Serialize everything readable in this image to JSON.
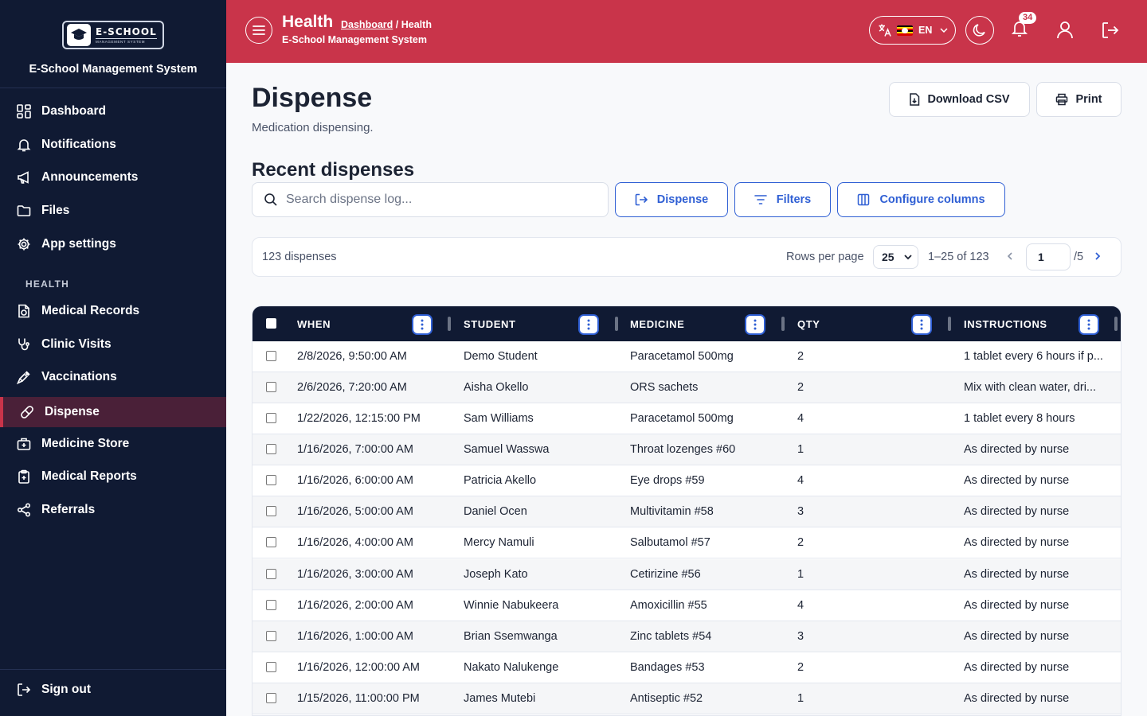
{
  "app": {
    "brand_logo_main": "E-SCHOOL",
    "brand_logo_sub": "MANAGEMENT SYSTEM",
    "brand_name": "E-School Management System"
  },
  "sidebar": {
    "items": [
      {
        "label": "Dashboard",
        "icon": "dashboard-icon"
      },
      {
        "label": "Notifications",
        "icon": "bell-icon"
      },
      {
        "label": "Announcements",
        "icon": "megaphone-icon"
      },
      {
        "label": "Files",
        "icon": "folder-icon"
      },
      {
        "label": "App settings",
        "icon": "gear-icon"
      }
    ],
    "section_label": "HEALTH",
    "health_items": [
      {
        "label": "Medical Records",
        "icon": "medical-file-icon"
      },
      {
        "label": "Clinic Visits",
        "icon": "stethoscope-icon"
      },
      {
        "label": "Vaccinations",
        "icon": "syringe-icon"
      },
      {
        "label": "Dispense",
        "icon": "pill-icon",
        "active": true
      },
      {
        "label": "Medicine Store",
        "icon": "medkit-icon"
      },
      {
        "label": "Medical Reports",
        "icon": "clipboard-plus-icon"
      },
      {
        "label": "Referrals",
        "icon": "share-icon"
      }
    ],
    "signout_label": "Sign out"
  },
  "header": {
    "title": "Health",
    "breadcrumb_link": "Dashboard",
    "breadcrumb_sep": "/",
    "breadcrumb_current": "Health",
    "subtitle": "E-School Management System",
    "language_code": "EN",
    "notification_count": "34",
    "accent_color": "#c9344a"
  },
  "page": {
    "title": "Dispense",
    "subtitle": "Medication dispensing.",
    "download_csv_label": "Download CSV",
    "print_label": "Print",
    "section_title": "Recent dispenses",
    "search_placeholder": "Search dispense log...",
    "dispense_button_label": "Dispense",
    "filters_button_label": "Filters",
    "configure_columns_label": "Configure columns"
  },
  "pager": {
    "count_text": "123 dispenses",
    "rows_per_page_label": "Rows per page",
    "rows_per_page_value": "25",
    "range_text": "1–25 of 123",
    "current_page": "1",
    "total_pages_text": "/5"
  },
  "table": {
    "columns": [
      "WHEN",
      "STUDENT",
      "MEDICINE",
      "QTY",
      "INSTRUCTIONS"
    ],
    "rows": [
      [
        "2/8/2026, 9:50:00 AM",
        "Demo Student",
        "Paracetamol 500mg",
        "2",
        "1 tablet every 6 hours if p..."
      ],
      [
        "2/6/2026, 7:20:00 AM",
        "Aisha Okello",
        "ORS sachets",
        "2",
        "Mix with clean water, dri..."
      ],
      [
        "1/22/2026, 12:15:00 PM",
        "Sam Williams",
        "Paracetamol 500mg",
        "4",
        "1 tablet every 8 hours"
      ],
      [
        "1/16/2026, 7:00:00 AM",
        "Samuel Wasswa",
        "Throat lozenges #60",
        "1",
        "As directed by nurse"
      ],
      [
        "1/16/2026, 6:00:00 AM",
        "Patricia Akello",
        "Eye drops #59",
        "4",
        "As directed by nurse"
      ],
      [
        "1/16/2026, 5:00:00 AM",
        "Daniel Ocen",
        "Multivitamin #58",
        "3",
        "As directed by nurse"
      ],
      [
        "1/16/2026, 4:00:00 AM",
        "Mercy Namuli",
        "Salbutamol #57",
        "2",
        "As directed by nurse"
      ],
      [
        "1/16/2026, 3:00:00 AM",
        "Joseph Kato",
        "Cetirizine #56",
        "1",
        "As directed by nurse"
      ],
      [
        "1/16/2026, 2:00:00 AM",
        "Winnie Nabukeera",
        "Amoxicillin #55",
        "4",
        "As directed by nurse"
      ],
      [
        "1/16/2026, 1:00:00 AM",
        "Brian Ssemwanga",
        "Zinc tablets #54",
        "3",
        "As directed by nurse"
      ],
      [
        "1/16/2026, 12:00:00 AM",
        "Nakato Nalukenge",
        "Bandages #53",
        "2",
        "As directed by nurse"
      ],
      [
        "1/15/2026, 11:00:00 PM",
        "James Mutebi",
        "Antiseptic #52",
        "1",
        "As directed by nurse"
      ]
    ]
  }
}
